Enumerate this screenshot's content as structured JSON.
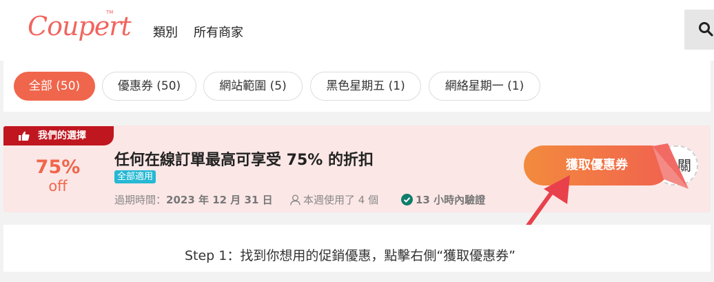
{
  "header": {
    "logo_text": "Coupert",
    "logo_tm": "TM",
    "nav": [
      "類別",
      "所有商家"
    ]
  },
  "filters": [
    {
      "label": "全部 (50)",
      "active": true
    },
    {
      "label": "優惠券 (50)",
      "active": false
    },
    {
      "label": "網站範圍 (5)",
      "active": false
    },
    {
      "label": "黑色星期五 (1)",
      "active": false
    },
    {
      "label": "網絡星期一 (1)",
      "active": false
    }
  ],
  "deal": {
    "badge": "我們的選擇",
    "percent": "75%",
    "off": "off",
    "title": "任何在線訂單最高可享受 75% 的折扣",
    "scope": "全部適用",
    "expiry_label": "過期時間：",
    "expiry_date": "2023 年 12 月 31 日",
    "usage": "本週使用了 4 個",
    "verified": "13 小時內驗證",
    "button_label": "獲取優惠券",
    "code_peek": "關"
  },
  "instruction": "Step 1：找到你想用的促銷優惠，點擊右側“獲取優惠券”",
  "colors": {
    "brand": "#f0655f",
    "accent": "#f0664c",
    "badge": "#c0161f",
    "scope_tag": "#26b8d4",
    "verified": "#0f7d6a",
    "arrow": "#e8414b"
  },
  "icons": {
    "search": "search-icon",
    "thumbs_up": "thumbs-up-icon",
    "user": "user-icon",
    "verified": "check-circle-icon",
    "arrow": "pointer-arrow-icon"
  }
}
